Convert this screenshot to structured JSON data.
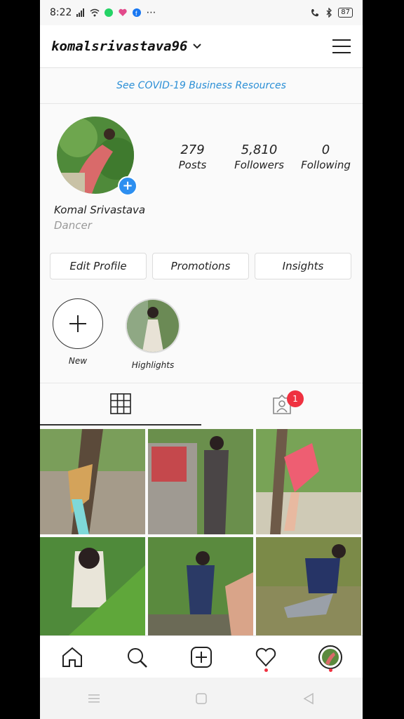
{
  "status": {
    "time": "8:22",
    "battery": "87"
  },
  "header": {
    "username": "komalsrivastava96"
  },
  "banner": {
    "text": "See COVID-19 Business Resources"
  },
  "profile": {
    "stats": [
      {
        "num": "279",
        "label": "Posts"
      },
      {
        "num": "5,810",
        "label": "Followers"
      },
      {
        "num": "0",
        "label": "Following"
      }
    ],
    "name": "Komal Srivastava",
    "bio": "Dancer"
  },
  "actions": {
    "edit": "Edit Profile",
    "promotions": "Promotions",
    "insights": "Insights"
  },
  "highlights": [
    {
      "label": "New"
    },
    {
      "label": "Highlights"
    }
  ],
  "tabs": {
    "tagged_badge": "1"
  },
  "colors": {
    "accent": "#2d8ff0",
    "badge": "#ef3140",
    "link": "#2b8fd6"
  }
}
